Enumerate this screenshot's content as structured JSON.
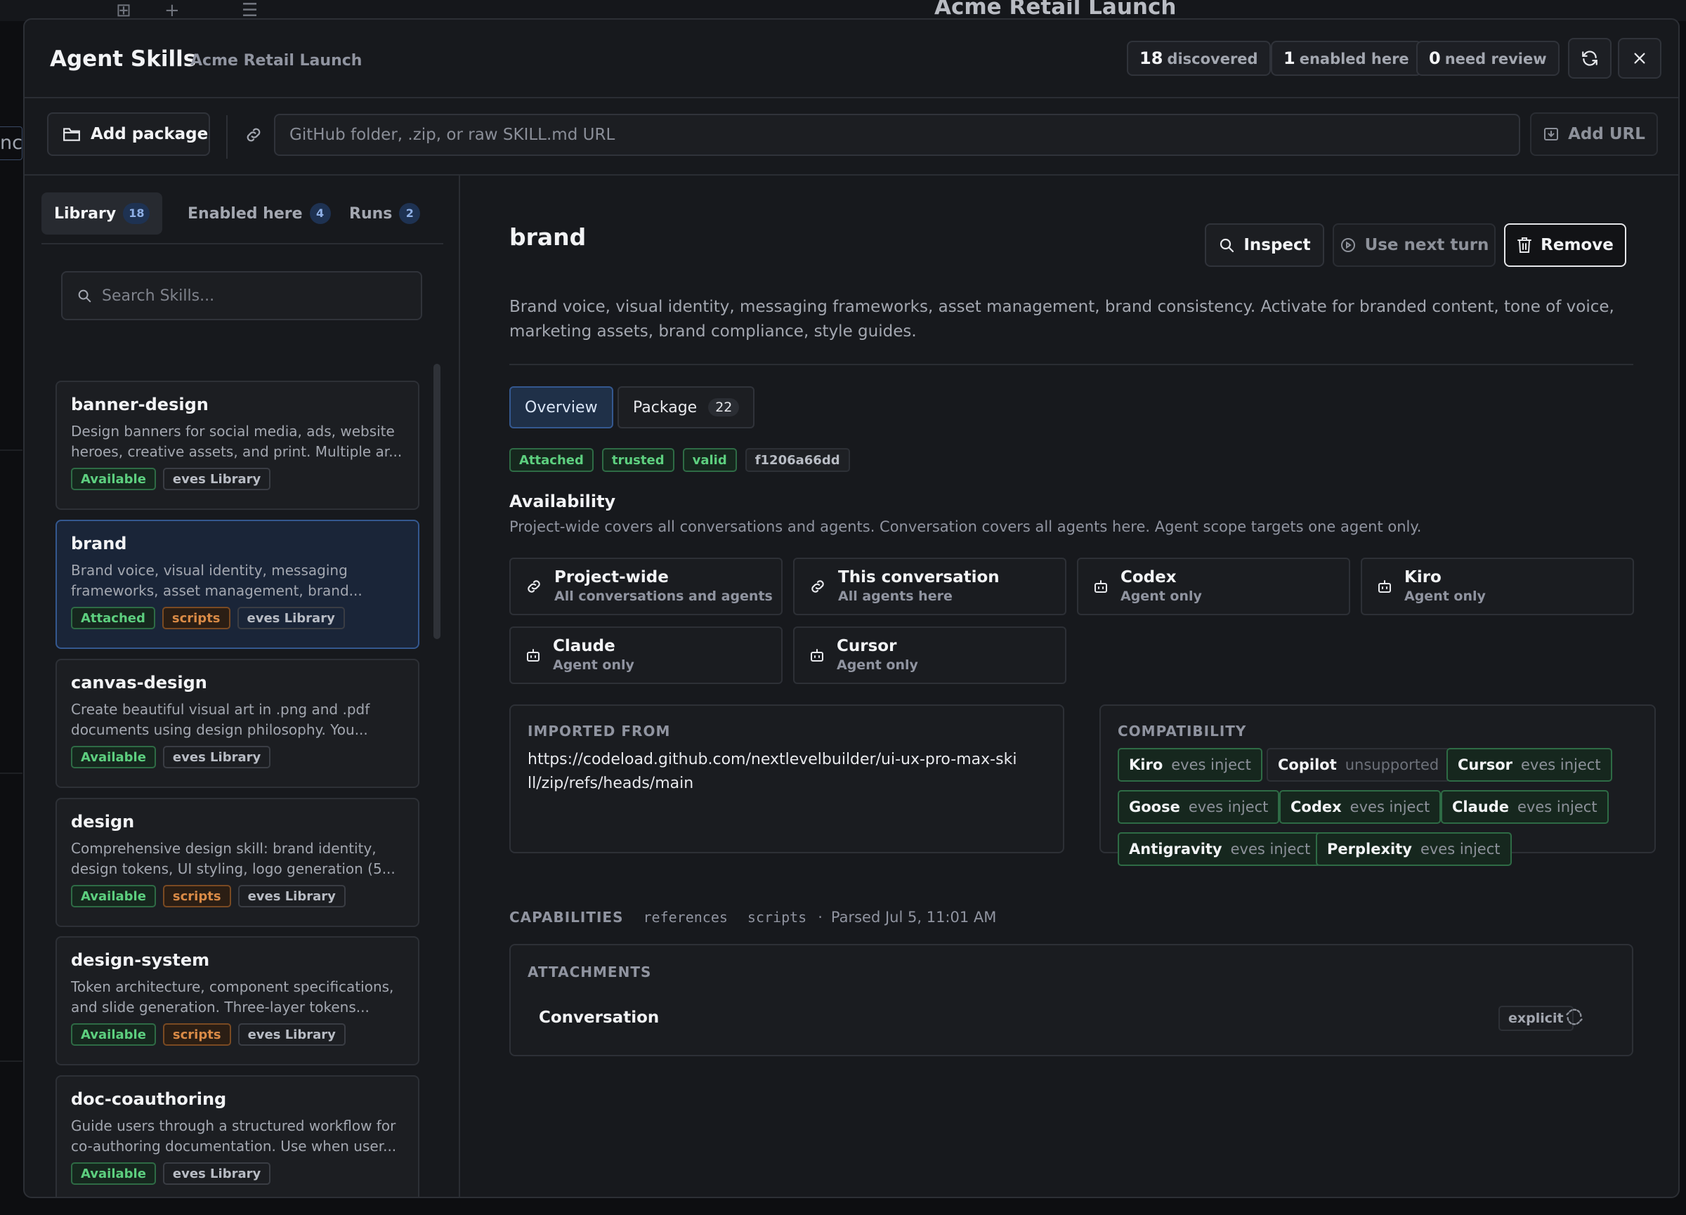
{
  "background": {
    "window_title": "Acme Retail Launch",
    "left_fragment": "nc"
  },
  "header": {
    "title": "Agent Skills",
    "project": "Acme Retail Launch",
    "stats": [
      {
        "value": "18",
        "label": "discovered"
      },
      {
        "value": "1",
        "label": "enabled here"
      },
      {
        "value": "0",
        "label": "need review"
      }
    ]
  },
  "toolbar": {
    "add_package_label": "Add package",
    "url_placeholder": "GitHub folder, .zip, or raw SKILL.md URL",
    "add_url_label": "Add URL"
  },
  "sidebar": {
    "tabs": [
      {
        "label": "Library",
        "count": "18"
      },
      {
        "label": "Enabled here",
        "count": "4"
      },
      {
        "label": "Runs",
        "count": "2"
      }
    ],
    "search_placeholder": "Search Skills...",
    "skills": [
      {
        "name": "banner-design",
        "desc": "Design banners for social media, ads, website heroes, creative assets, and print. Multiple ar...",
        "tags": [
          "Available",
          "eves Library"
        ]
      },
      {
        "name": "brand",
        "desc": "Brand voice, visual identity, messaging frameworks, asset management, brand...",
        "tags": [
          "Attached",
          "scripts",
          "eves Library"
        ]
      },
      {
        "name": "canvas-design",
        "desc": "Create beautiful visual art in .png and .pdf documents using design philosophy. You...",
        "tags": [
          "Available",
          "eves Library"
        ]
      },
      {
        "name": "design",
        "desc": "Comprehensive design skill: brand identity, design tokens, UI styling, logo generation (5...",
        "tags": [
          "Available",
          "scripts",
          "eves Library"
        ]
      },
      {
        "name": "design-system",
        "desc": "Token architecture, component specifications, and slide generation. Three-layer tokens...",
        "tags": [
          "Available",
          "scripts",
          "eves Library"
        ]
      },
      {
        "name": "doc-coauthoring",
        "desc": "Guide users through a structured workflow for co-authoring documentation. Use when user...",
        "tags": [
          "Available",
          "eves Library"
        ]
      }
    ]
  },
  "detail": {
    "title": "brand",
    "actions": {
      "inspect": "Inspect",
      "use_next_turn": "Use next turn",
      "remove": "Remove"
    },
    "description": "Brand voice, visual identity, messaging frameworks, asset management, brand consistency. Activate for branded content, tone of voice, marketing assets, brand compliance, style guides.",
    "tabs": {
      "overview": "Overview",
      "package": "Package",
      "package_count": "22"
    },
    "badges": [
      "Attached",
      "trusted",
      "valid",
      "f1206a66dd"
    ],
    "availability": {
      "heading": "Availability",
      "note": "Project-wide covers all conversations and agents. Conversation covers all agents here. Agent scope targets one agent only.",
      "scopes": [
        {
          "title": "Project-wide",
          "sub": "All conversations and agents",
          "icon": "link-icon"
        },
        {
          "title": "This conversation",
          "sub": "All agents here",
          "icon": "link-icon"
        },
        {
          "title": "Codex",
          "sub": "Agent only",
          "icon": "robot-icon"
        },
        {
          "title": "Kiro",
          "sub": "Agent only",
          "icon": "robot-icon"
        },
        {
          "title": "Claude",
          "sub": "Agent only",
          "icon": "robot-icon"
        },
        {
          "title": "Cursor",
          "sub": "Agent only",
          "icon": "robot-icon"
        }
      ]
    },
    "imported": {
      "label": "IMPORTED FROM",
      "url": "https://codeload.github.com/nextlevelbuilder/ui-ux-pro-max-skill/zip/refs/heads/main"
    },
    "compatibility": {
      "label": "COMPATIBILITY",
      "items": [
        {
          "name": "Kiro",
          "status": "eves inject"
        },
        {
          "name": "Copilot",
          "status": "unsupported"
        },
        {
          "name": "Cursor",
          "status": "eves inject"
        },
        {
          "name": "Goose",
          "status": "eves inject"
        },
        {
          "name": "Codex",
          "status": "eves inject"
        },
        {
          "name": "Claude",
          "status": "eves inject"
        },
        {
          "name": "Antigravity",
          "status": "eves inject"
        },
        {
          "name": "Perplexity",
          "status": "eves inject"
        }
      ]
    },
    "capabilities": {
      "label": "CAPABILITIES",
      "items": [
        "references",
        "scripts"
      ],
      "separator": "·",
      "parsed": "Parsed Jul 5, 11:01 AM"
    },
    "attachments": {
      "label": "ATTACHMENTS",
      "row": {
        "name": "Conversation",
        "mode": "explicit"
      }
    }
  },
  "colors": {
    "accent_blue": "#34588f",
    "green": "#5dcf7f",
    "orange": "#d98a46"
  }
}
